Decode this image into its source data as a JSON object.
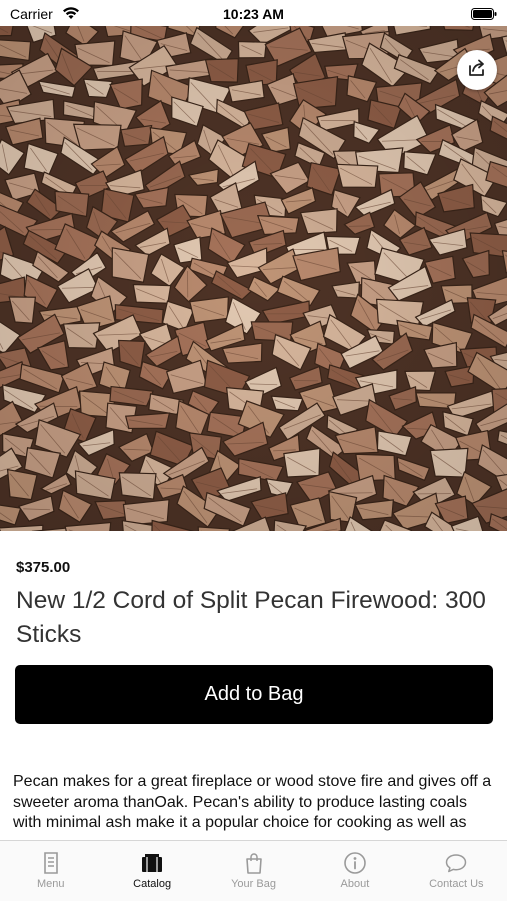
{
  "status_bar": {
    "carrier": "Carrier",
    "time": "10:23 AM",
    "icons": [
      "wifi-icon",
      "battery-icon"
    ]
  },
  "hero": {
    "image": "split pecan firewood stack photo",
    "share_icon": "share-icon"
  },
  "product": {
    "price": "$375.00",
    "title": "New 1/2 Cord of Split Pecan Firewood: 300 Sticks",
    "add_to_bag_label": "Add to Bag",
    "description": "Pecan makes for a great fireplace or wood stove fire and gives off a sweeter aroma thanOak. Pecan's ability to produce lasting coals with minimal ash make it a popular choice for cooking as well as heating. It offers some fla"
  },
  "tab_bar": {
    "active_color": "#111111",
    "inactive_color": "#9a9a9a",
    "tabs": [
      {
        "label": "Menu",
        "icon": "menu-document-icon",
        "active": false
      },
      {
        "label": "Catalog",
        "icon": "catalog-icon",
        "active": true
      },
      {
        "label": "Your Bag",
        "icon": "bag-icon",
        "active": false
      },
      {
        "label": "About",
        "icon": "info-icon",
        "active": false
      },
      {
        "label": "Contact Us",
        "icon": "chat-bubble-icon",
        "active": false
      }
    ]
  },
  "colors": {
    "button_background": "#000000",
    "button_text": "#ffffff",
    "title_text": "#333333"
  }
}
